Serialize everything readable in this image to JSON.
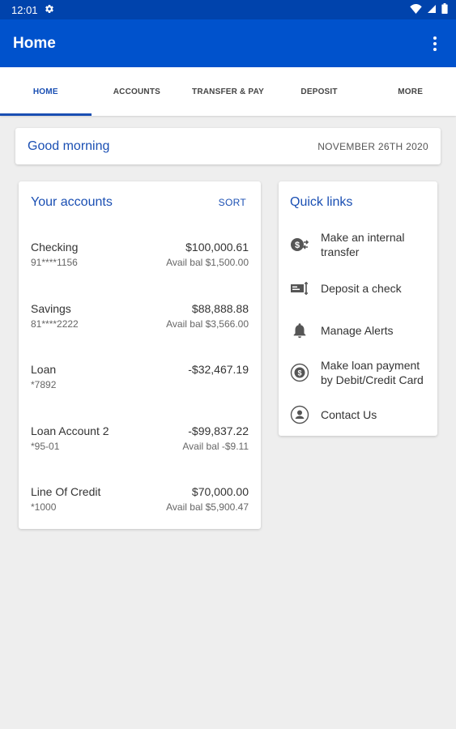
{
  "status": {
    "time": "12:01"
  },
  "app_bar": {
    "title": "Home"
  },
  "tabs": [
    {
      "label": "HOME"
    },
    {
      "label": "ACCOUNTS"
    },
    {
      "label": "TRANSFER & PAY"
    },
    {
      "label": "DEPOSIT"
    },
    {
      "label": "MORE"
    }
  ],
  "greeting": {
    "text": "Good morning",
    "date": "NOVEMBER 26TH 2020"
  },
  "accounts": {
    "title": "Your accounts",
    "sort_label": "SORT",
    "items": [
      {
        "name": "Checking",
        "number": "91****1156",
        "balance": "$100,000.61",
        "avail": "Avail bal $1,500.00"
      },
      {
        "name": "Savings",
        "number": "81****2222",
        "balance": "$88,888.88",
        "avail": "Avail bal $3,566.00"
      },
      {
        "name": "Loan",
        "number": "*7892",
        "balance": "-$32,467.19",
        "avail": ""
      },
      {
        "name": "Loan Account 2",
        "number": "*95-01",
        "balance": "-$99,837.22",
        "avail": "Avail bal -$9.11"
      },
      {
        "name": "Line Of Credit",
        "number": "*1000",
        "balance": "$70,000.00",
        "avail": "Avail bal $5,900.47"
      }
    ]
  },
  "quick_links": {
    "title": "Quick links",
    "items": [
      {
        "label": "Make an internal transfer",
        "icon": "transfer-icon"
      },
      {
        "label": "Deposit a check",
        "icon": "check-deposit-icon"
      },
      {
        "label": "Manage Alerts",
        "icon": "bell-icon"
      },
      {
        "label": "Make loan payment by Debit/Credit Card",
        "icon": "loan-payment-icon"
      },
      {
        "label": "Contact Us",
        "icon": "contact-icon"
      }
    ]
  },
  "colors": {
    "status_bar": "#0043ac",
    "app_bar": "#0052cc",
    "accent": "#1a4fb3",
    "background": "#eeeeee"
  }
}
